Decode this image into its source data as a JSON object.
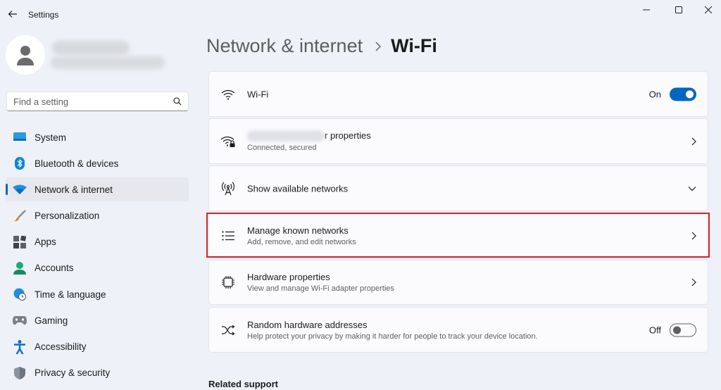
{
  "app": {
    "title": "Settings"
  },
  "search": {
    "placeholder": "Find a setting"
  },
  "nav": [
    {
      "label": "System",
      "icon": "system-icon",
      "color": "#0a86d6"
    },
    {
      "label": "Bluetooth & devices",
      "icon": "bluetooth-icon",
      "color": "#0a86d6"
    },
    {
      "label": "Network & internet",
      "icon": "wifi-icon",
      "color": "#0a86d6",
      "active": true
    },
    {
      "label": "Personalization",
      "icon": "brush-icon",
      "color": "#d9822b"
    },
    {
      "label": "Apps",
      "icon": "apps-icon",
      "color": "#4a4f5a"
    },
    {
      "label": "Accounts",
      "icon": "accounts-icon",
      "color": "#1fa77a"
    },
    {
      "label": "Time & language",
      "icon": "globe-clock-icon",
      "color": "#0a86d6"
    },
    {
      "label": "Gaming",
      "icon": "gamepad-icon",
      "color": "#6b7280"
    },
    {
      "label": "Accessibility",
      "icon": "accessibility-icon",
      "color": "#0a6fc9"
    },
    {
      "label": "Privacy & security",
      "icon": "shield-icon",
      "color": "#6b7280"
    }
  ],
  "breadcrumb": {
    "parent": "Network & internet",
    "current": "Wi-Fi"
  },
  "cards": {
    "wifi": {
      "title": "Wi-Fi",
      "toggle_label": "On",
      "toggle_on": true
    },
    "properties": {
      "title_suffix": "r properties",
      "subtitle": "Connected, secured"
    },
    "available": {
      "title": "Show available networks"
    },
    "manage": {
      "title": "Manage known networks",
      "subtitle": "Add, remove, and edit networks"
    },
    "hardware": {
      "title": "Hardware properties",
      "subtitle": "View and manage Wi-Fi adapter properties"
    },
    "random": {
      "title": "Random hardware addresses",
      "subtitle": "Help protect your privacy by making it harder for people to track your device location.",
      "toggle_label": "Off",
      "toggle_on": false
    }
  },
  "related": {
    "title": "Related support"
  },
  "colors": {
    "accent": "#0067c0",
    "highlight": "#d7222b"
  }
}
